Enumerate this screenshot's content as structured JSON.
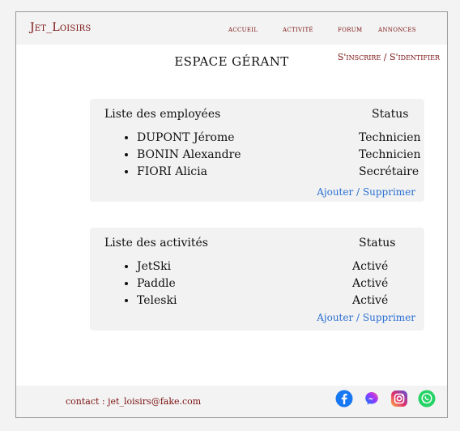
{
  "header": {
    "brand": "Jet_Loisirs",
    "nav": [
      "accueil",
      "activité",
      "forum",
      "annonces"
    ],
    "auth": "S'inscrire / S'identifier"
  },
  "page_title": "ESPACE GÉRANT",
  "employees": {
    "title": "Liste des employées",
    "status_header": "Status",
    "items": [
      {
        "name": "DUPONT Jérome",
        "status": "Technicien"
      },
      {
        "name": "BONIN Alexandre",
        "status": "Technicien"
      },
      {
        "name": "FIORI Alicia",
        "status": "Secrétaire"
      }
    ],
    "actions": "Ajouter / Supprimer"
  },
  "activities": {
    "title": "Liste des activités",
    "status_header": "Status",
    "items": [
      {
        "name": "JetSki",
        "status": "Activé"
      },
      {
        "name": "Paddle",
        "status": "Activé"
      },
      {
        "name": "Teleski",
        "status": "Activé"
      }
    ],
    "actions": "Ajouter / Supprimer"
  },
  "footer": {
    "contact": "contact : jet_loisirs@fake.com",
    "social_icons": [
      "facebook-icon",
      "messenger-icon",
      "instagram-icon",
      "whatsapp-icon"
    ]
  },
  "colors": {
    "brand": "#7a1010",
    "link": "#2a6fd3",
    "panel": "#f2f2f2"
  }
}
